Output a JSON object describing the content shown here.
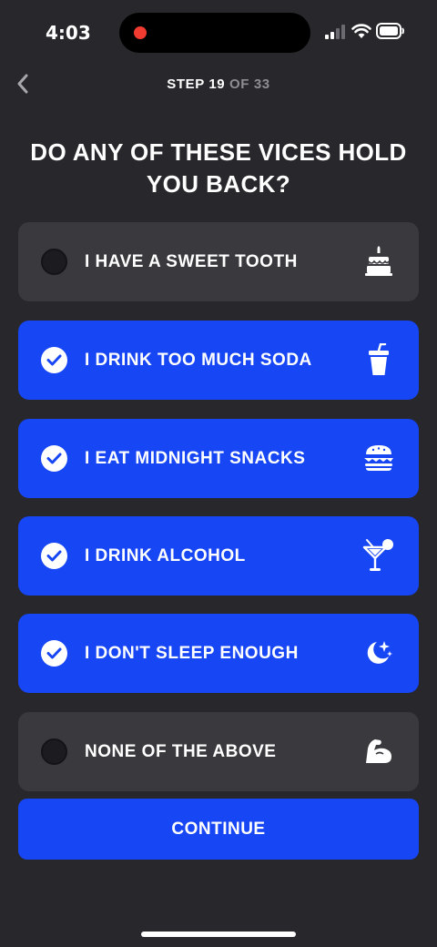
{
  "status_bar": {
    "time": "4:03",
    "recording_indicator_color": "#f23b30"
  },
  "header": {
    "back_icon": "chevron-left-icon",
    "step_current": "STEP 19",
    "step_total": "OF 33"
  },
  "question": "DO ANY OF THESE VICES HOLD YOU BACK?",
  "options": [
    {
      "label": "I HAVE A SWEET TOOTH",
      "selected": false,
      "icon": "cake-icon"
    },
    {
      "label": "I DRINK TOO MUCH SODA",
      "selected": true,
      "icon": "soda-cup-icon"
    },
    {
      "label": "I EAT MIDNIGHT SNACKS",
      "selected": true,
      "icon": "burger-icon"
    },
    {
      "label": "I DRINK ALCOHOL",
      "selected": true,
      "icon": "cocktail-icon"
    },
    {
      "label": "I DON'T SLEEP ENOUGH",
      "selected": true,
      "icon": "moon-stars-icon"
    },
    {
      "label": "NONE OF THE ABOVE",
      "selected": false,
      "icon": "flexed-bicep-icon"
    }
  ],
  "continue_label": "CONTINUE",
  "colors": {
    "background": "#28272b",
    "accent": "#1746f5",
    "unselected_option": "#3a393e"
  }
}
